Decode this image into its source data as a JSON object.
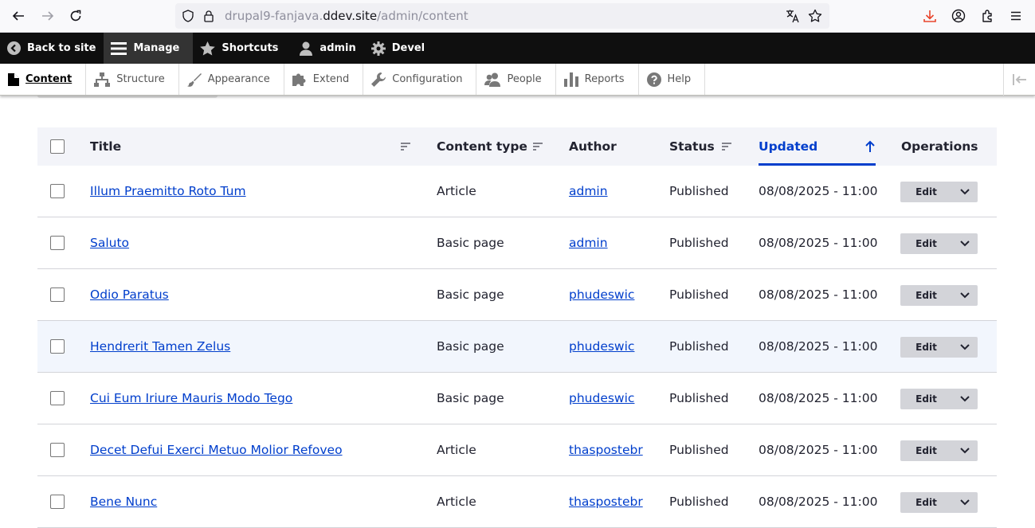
{
  "browser": {
    "url_prefix": "drupal9-fanjava.",
    "url_host": "ddev.site",
    "url_path": "/admin/content"
  },
  "toolbar": {
    "items": [
      {
        "label": "Back to site",
        "icon": "back-circle-icon"
      },
      {
        "label": "Manage",
        "icon": "hamburger-icon"
      },
      {
        "label": "Shortcuts",
        "icon": "star-icon"
      },
      {
        "label": "admin",
        "icon": "user-icon"
      },
      {
        "label": "Devel",
        "icon": "gear-icon"
      }
    ]
  },
  "tray": {
    "items": [
      {
        "label": "Content",
        "icon": "file-icon"
      },
      {
        "label": "Structure",
        "icon": "structure-icon"
      },
      {
        "label": "Appearance",
        "icon": "brush-icon"
      },
      {
        "label": "Extend",
        "icon": "puzzle-icon"
      },
      {
        "label": "Configuration",
        "icon": "wrench-icon"
      },
      {
        "label": "People",
        "icon": "people-icon"
      },
      {
        "label": "Reports",
        "icon": "bar-chart-icon"
      },
      {
        "label": "Help",
        "icon": "help-icon"
      }
    ]
  },
  "table": {
    "headers": {
      "title": "Title",
      "content_type": "Content type",
      "author": "Author",
      "status": "Status",
      "updated": "Updated",
      "operations": "Operations"
    },
    "edit_label": "Edit",
    "rows": [
      {
        "title": "Illum Praemitto Roto Tum",
        "type": "Article",
        "author": "admin",
        "status": "Published",
        "updated": "08/08/2025 - 11:00"
      },
      {
        "title": "Saluto",
        "type": "Basic page",
        "author": "admin",
        "status": "Published",
        "updated": "08/08/2025 - 11:00"
      },
      {
        "title": "Odio Paratus",
        "type": "Basic page",
        "author": "phudeswic",
        "status": "Published",
        "updated": "08/08/2025 - 11:00"
      },
      {
        "title": "Hendrerit Tamen Zelus",
        "type": "Basic page",
        "author": "phudeswic",
        "status": "Published",
        "updated": "08/08/2025 - 11:00"
      },
      {
        "title": "Cui Eum Iriure Mauris Modo Tego",
        "type": "Basic page",
        "author": "phudeswic",
        "status": "Published",
        "updated": "08/08/2025 - 11:00"
      },
      {
        "title": "Decet Defui Exerci Metuo Molior Refoveo",
        "type": "Article",
        "author": "thaspostebr",
        "status": "Published",
        "updated": "08/08/2025 - 11:00"
      },
      {
        "title": "Bene Nunc",
        "type": "Article",
        "author": "thaspostebr",
        "status": "Published",
        "updated": "08/08/2025 - 11:00"
      }
    ]
  },
  "colors": {
    "link": "#003ecc",
    "toolbar_bg": "#0f0f0f",
    "header_bg": "#f3f4f9"
  }
}
